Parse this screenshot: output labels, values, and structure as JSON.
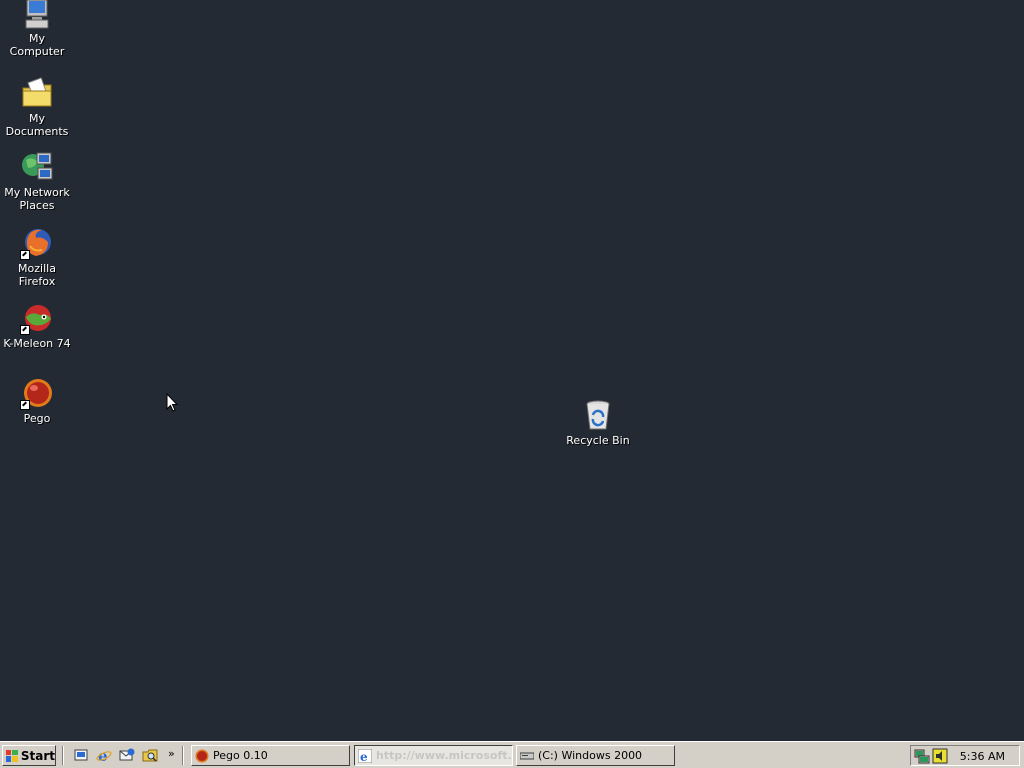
{
  "desktop": {
    "icons": [
      {
        "label": "My Computer"
      },
      {
        "label": "My Documents"
      },
      {
        "label": "My Network Places"
      },
      {
        "label": "Mozilla Firefox"
      },
      {
        "label": "K-Meleon 74"
      },
      {
        "label": "Pego"
      },
      {
        "label": "Recycle Bin"
      }
    ]
  },
  "taskbar": {
    "start_label": "Start",
    "more_label": "»",
    "tasks": [
      {
        "label": "Pego 0.10"
      },
      {
        "label": "http://www.microsoft..."
      },
      {
        "label": "(C:) Windows 2000"
      }
    ],
    "clock": "5:36 AM"
  }
}
